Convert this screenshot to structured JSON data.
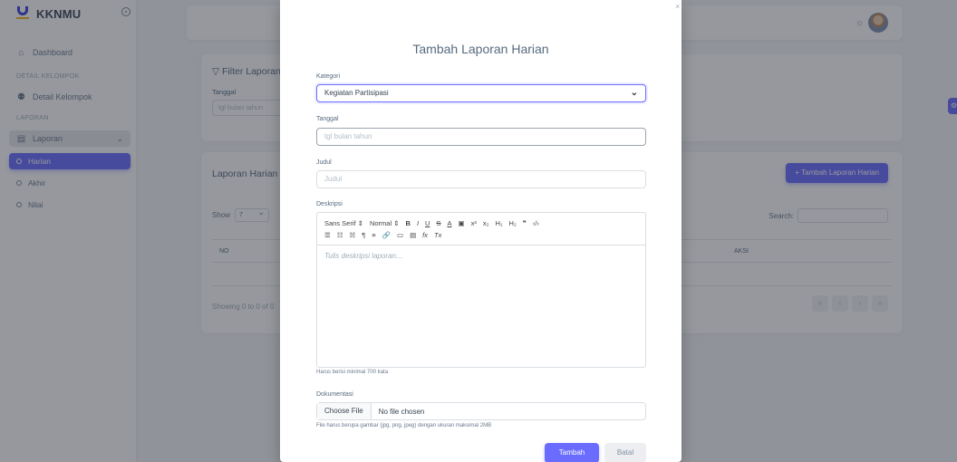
{
  "app": {
    "brand": "KKNMU"
  },
  "sidebar": {
    "dashboard": "Dashboard",
    "section_detail": "DETAIL KELOMPOK",
    "detail_kelompok": "Detail Kelompok",
    "section_laporan": "LAPORAN",
    "laporan": "Laporan",
    "sub_items": [
      "Harian",
      "Akhir",
      "Nilai"
    ],
    "active_item": "Harian"
  },
  "filter": {
    "title": "Filter Laporan",
    "date_label": "Tanggal",
    "date_placeholder": "tgl bulan tahun"
  },
  "list": {
    "title": "Laporan Harian",
    "add_button": "+ Tambah Laporan Harian",
    "show_label": "Show",
    "show_value": "7",
    "search_label": "Search:",
    "columns": [
      "NO",
      "AKSI"
    ],
    "showing_text": "Showing 0 to 0 of 0",
    "pager": [
      "«",
      "‹",
      "›",
      "»"
    ]
  },
  "modal": {
    "title": "Tambah Laporan Harian",
    "close": "×",
    "kategori_label": "Kategori",
    "kategori_value": "Kegiatan Partisipasi",
    "tanggal_label": "Tanggal",
    "tanggal_placeholder": "tgl bulan tahun",
    "judul_label": "Judul",
    "judul_placeholder": "Judul",
    "deskripsi_label": "Deskripsi",
    "toolbar_row1": [
      "Sans Serif ⇕",
      "Normal ⇕",
      "B",
      "I",
      "U",
      "S",
      "A",
      "▣",
      "x²",
      "x₂",
      "H₁",
      "H₂",
      "❞",
      "‹/›"
    ],
    "toolbar_row2": [
      "☰",
      "☷",
      "☵",
      "¶",
      "≡",
      "🔗",
      "▭",
      "▤",
      "fx",
      "Tx"
    ],
    "editor_placeholder": "Tulis deskripsi laporan...",
    "deskripsi_help": "Harus berisi minimal 700 kata",
    "dokumentasi_label": "Dokumentasi",
    "file_button": "Choose File",
    "file_status": "No file chosen",
    "file_help": "File harus berupa gambar (jpg, png, jpeg) dengan ukuran maksimal 2MB",
    "submit": "Tambah",
    "cancel": "Batal"
  },
  "colors": {
    "primary": "#696cff",
    "backdrop": "#23283280"
  },
  "icons": [
    "home-icon",
    "group-icon",
    "file-icon",
    "chevron-down-icon",
    "sun-icon",
    "avatar",
    "gear-icon",
    "close-icon"
  ]
}
